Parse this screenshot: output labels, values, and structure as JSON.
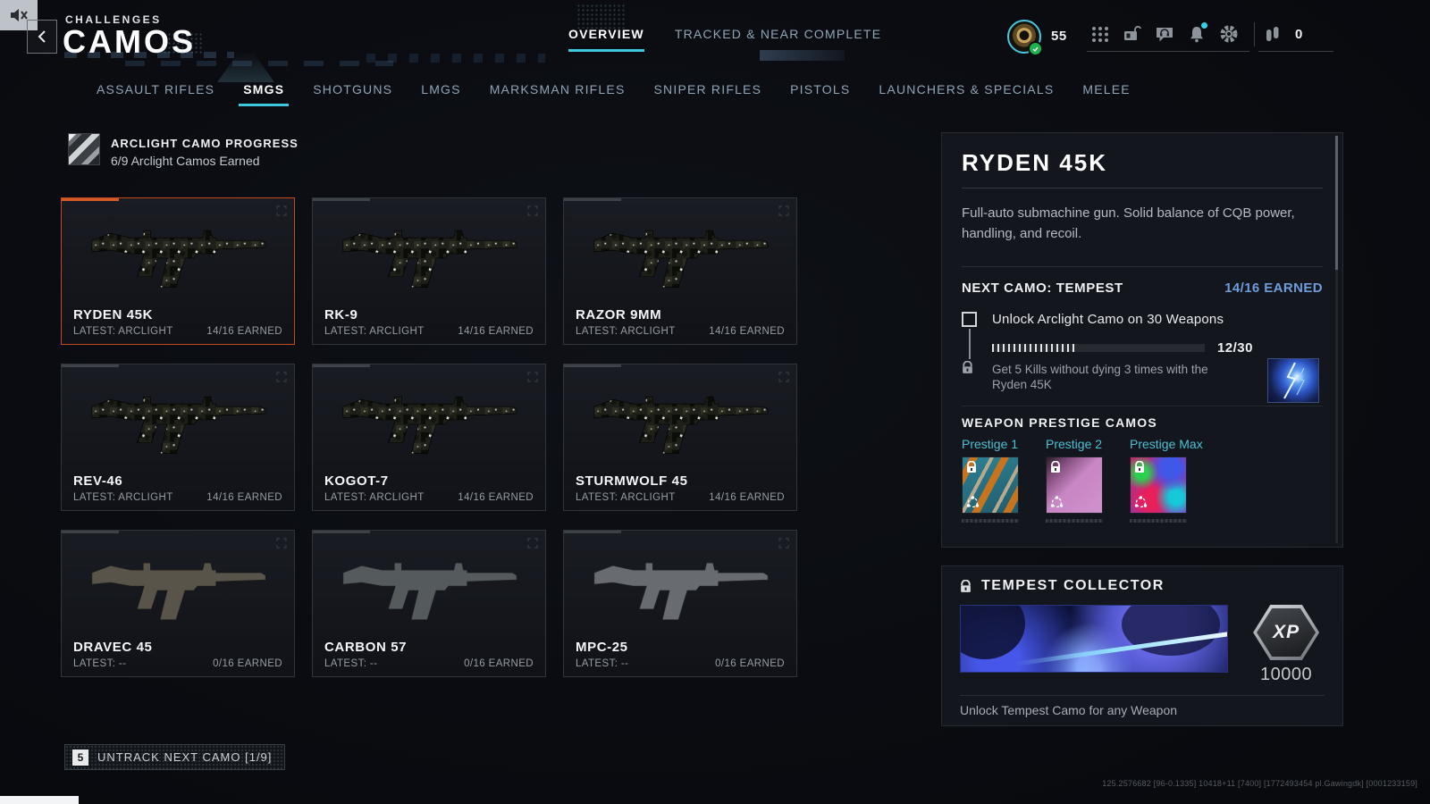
{
  "colors": {
    "accent_cyan": "#3ec8de",
    "selected_orange": "#c24a1f",
    "earned_blue": "#6f9cdb"
  },
  "header": {
    "kicker": "CHALLENGES",
    "title": "CAMOS"
  },
  "view_tabs": [
    {
      "label": "OVERVIEW",
      "active": true
    },
    {
      "label": "TRACKED & NEAR COMPLETE",
      "active": false
    }
  ],
  "hud": {
    "level": "55",
    "currency_value": "0",
    "emblem": "prestige-rank-emblem",
    "icons": [
      "apps-grid-icon",
      "locker-card-icon",
      "social-chat-icon",
      "notifications-icon",
      "settings-icon"
    ],
    "currency_icon": "cod-points-icon"
  },
  "weapon_tabs": [
    {
      "label": "ASSAULT RIFLES",
      "active": false
    },
    {
      "label": "SMGS",
      "active": true
    },
    {
      "label": "SHOTGUNS",
      "active": false
    },
    {
      "label": "LMGS",
      "active": false
    },
    {
      "label": "MARKSMAN RIFLES",
      "active": false
    },
    {
      "label": "SNIPER RIFLES",
      "active": false
    },
    {
      "label": "PISTOLS",
      "active": false
    },
    {
      "label": "LAUNCHERS & SPECIALS",
      "active": false
    },
    {
      "label": "MELEE",
      "active": false
    }
  ],
  "camo_progress": {
    "title": "ARCLIGHT CAMO PROGRESS",
    "subtitle": "6/9 Arclight Camos Earned"
  },
  "weapons": [
    {
      "name": "RYDEN 45K",
      "latest": "LATEST: ARCLIGHT",
      "earned": "14/16 EARNED",
      "selected": true,
      "variant": "camo"
    },
    {
      "name": "RK-9",
      "latest": "LATEST: ARCLIGHT",
      "earned": "14/16 EARNED",
      "selected": false,
      "variant": "camo"
    },
    {
      "name": "RAZOR 9MM",
      "latest": "LATEST: ARCLIGHT",
      "earned": "14/16 EARNED",
      "selected": false,
      "variant": "camo"
    },
    {
      "name": "REV-46",
      "latest": "LATEST: ARCLIGHT",
      "earned": "14/16 EARNED",
      "selected": false,
      "variant": "camo"
    },
    {
      "name": "KOGOT-7",
      "latest": "LATEST: ARCLIGHT",
      "earned": "14/16 EARNED",
      "selected": false,
      "variant": "camo"
    },
    {
      "name": "STURMWOLF 45",
      "latest": "LATEST: ARCLIGHT",
      "earned": "14/16 EARNED",
      "selected": false,
      "variant": "camo"
    },
    {
      "name": "DRAVEC 45",
      "latest": "LATEST: --",
      "earned": "0/16 EARNED",
      "selected": false,
      "variant": "tan"
    },
    {
      "name": "CARBON 57",
      "latest": "LATEST: --",
      "earned": "0/16 EARNED",
      "selected": false,
      "variant": "steel"
    },
    {
      "name": "MPC-25",
      "latest": "LATEST: --",
      "earned": "0/16 EARNED",
      "selected": false,
      "variant": "grey"
    }
  ],
  "detail": {
    "title": "RYDEN 45K",
    "description": "Full-auto submachine gun. Solid balance of CQB power, handling, and recoil.",
    "next_camo_label": "NEXT CAMO: TEMPEST",
    "earned": "14/16 EARNED",
    "challenge": {
      "title": "Unlock Arclight Camo on 30 Weapons",
      "progress_label": "12/30",
      "progress_current": 12,
      "progress_total": 30,
      "subtext": "Get 5 Kills without dying 3 times with the Ryden 45K",
      "camo_thumbnail": "tempest-camo-thumbnail"
    },
    "prestige": {
      "heading": "WEAPON PRESTIGE CAMOS",
      "items": [
        {
          "label": "Prestige 1",
          "locked": true
        },
        {
          "label": "Prestige 2",
          "locked": true
        },
        {
          "label": "Prestige Max",
          "locked": true
        }
      ]
    }
  },
  "collector": {
    "title": "TEMPEST COLLECTOR",
    "locked": true,
    "reward_label": "XP",
    "reward_value": "10000",
    "subtitle": "Unlock Tempest Camo for any Weapon"
  },
  "footer": {
    "key_hint": "5",
    "untrack_label": "UNTRACK NEXT CAMO [1/9]"
  },
  "debug_text": "125.2576682 [96-0.1335] 10418+11 [7400] [1772493454 pl.Gawingdk] [0001233159]"
}
